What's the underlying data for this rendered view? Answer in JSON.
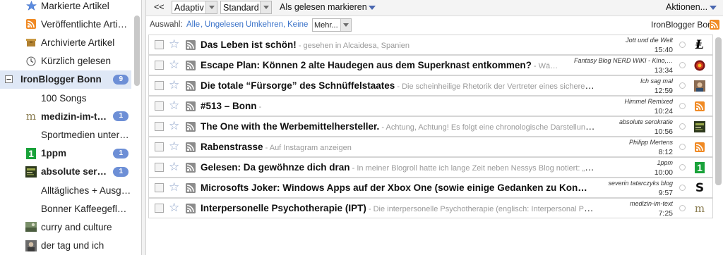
{
  "sidebar": {
    "items": [
      {
        "label": "Markierte Artikel",
        "icon": "star-icon",
        "bold": false,
        "badge": ""
      },
      {
        "label": "Veröffentlichte Arti…",
        "icon": "rss-icon",
        "bold": false,
        "badge": ""
      },
      {
        "label": "Archivierte Artikel",
        "icon": "archive-box-icon",
        "bold": false,
        "badge": ""
      },
      {
        "label": "Kürzlich gelesen",
        "icon": "clock-icon",
        "bold": false,
        "badge": ""
      },
      {
        "label": "IronBlogger Bonn",
        "icon": "collapse-icon",
        "bold": true,
        "badge": "9"
      },
      {
        "label": "100 Songs",
        "icon": "",
        "bold": false,
        "badge": ""
      },
      {
        "label": "medizin-im-t…",
        "icon": "letter-m-icon",
        "bold": true,
        "badge": "1"
      },
      {
        "label": "Sportmedien unter …",
        "icon": "",
        "bold": false,
        "badge": ""
      },
      {
        "label": "1ppm",
        "icon": "green-1-icon",
        "bold": true,
        "badge": "1"
      },
      {
        "label": "absolute sero…",
        "icon": "book-cover-icon",
        "bold": true,
        "badge": "1"
      },
      {
        "label": "Alltägliches + Ausg…",
        "icon": "",
        "bold": false,
        "badge": ""
      },
      {
        "label": "Bonner Kaffeegeflüs…",
        "icon": "",
        "bold": false,
        "badge": ""
      },
      {
        "label": "curry and culture",
        "icon": "thumbnail-icon",
        "bold": false,
        "badge": ""
      },
      {
        "label": "der tag und ich",
        "icon": "portrait-icon",
        "bold": false,
        "badge": ""
      }
    ]
  },
  "toolbar": {
    "back_label": "<<",
    "view_mode": "Adaptiv",
    "sort_mode": "Standard",
    "mark_read": "Als gelesen markieren",
    "actions": "Aktionen..."
  },
  "filterbar": {
    "prefix": "Auswahl:",
    "alle": "Alle",
    "ungelesen": "Ungelesen",
    "umkehren": "Umkehren",
    "keine": "Keine",
    "more": "Mehr...",
    "feed_name": "IronBlogger Bonn"
  },
  "articles": [
    {
      "title": "Das Leben ist schön!",
      "excerpt": " - gesehen in Alcaidesa, Spanien",
      "feed": "Jott und die Welt",
      "time": "15:40",
      "icon": "jott-glyph-icon"
    },
    {
      "title": "Escape Plan: Können 2 alte Haudegen aus dem Superknast entkommen?",
      "excerpt": " - Wä…",
      "feed": "Fantasy Blog NERD WIKI - Kino,…",
      "time": "13:34",
      "icon": "nerd-wiki-logo-icon"
    },
    {
      "title": "Die totale “Fürsorge” des Schnüffelstaates",
      "excerpt": " - Die scheinheilige Rhetorik der Vertreter eines sicheren…",
      "feed": "Ich sag mal",
      "time": "12:59",
      "icon": "avatar-photo-icon"
    },
    {
      "title": "#513 – Bonn",
      "excerpt": " -",
      "feed": "Himmel Remixed",
      "time": "10:24",
      "icon": "rss-orange-icon"
    },
    {
      "title": "The One with the Werbemittelhersteller.",
      "excerpt": " - Achtung, Achtung! Es folgt eine chronologische Darstellung…",
      "feed": "absolute serokratie",
      "time": "10:56",
      "icon": "book-cover-icon"
    },
    {
      "title": "Rabenstrasse",
      "excerpt": " - Auf Instagram anzeigen",
      "feed": "Philipp Mertens",
      "time": "8:12",
      "icon": "rss-orange-icon"
    },
    {
      "title": "Gelesen: Da gewöhnze dich dran",
      "excerpt": " - In meiner Blogroll hatte ich lange Zeit neben Nessys Blog notiert: „Fr…",
      "feed": "1ppm",
      "time": "10:00",
      "icon": "green-1-icon"
    },
    {
      "title": "Microsofts Joker: Windows Apps auf der Xbox One (sowie einige Gedanken zu Kon…",
      "excerpt": "",
      "feed": "severin tatarczyks blog",
      "time": "9:57",
      "icon": "letter-s-icon"
    },
    {
      "title": "Interpersonelle Psychotherapie (IPT)",
      "excerpt": " - Die interpersonelle Psychotherapie (englisch: Interpersonal Psy…",
      "feed": "medizin-im-text",
      "time": "7:25",
      "icon": "letter-m-icon"
    }
  ],
  "colors": {
    "accent": "#3b73c9",
    "badge": "#6d8fd6",
    "selected_row": "#dfe8f6",
    "rss_orange": "#f08a24"
  }
}
